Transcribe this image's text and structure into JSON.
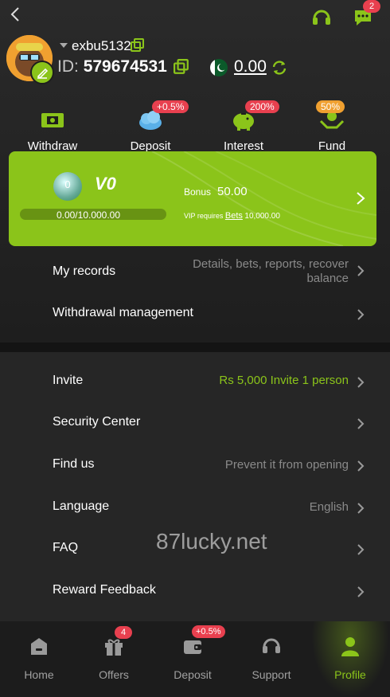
{
  "header": {
    "back_icon": "chevron-left-icon",
    "support_icon": "headset-icon",
    "messages_icon": "chat-icon",
    "messages_badge": "2"
  },
  "profile": {
    "username": "exbu5132",
    "id_label": "ID:",
    "id_value": "579674531",
    "balance": "0.00",
    "flag_icon": "pakistan-flag-icon"
  },
  "quick_actions": [
    {
      "label": "Withdraw",
      "icon": "ticket-icon",
      "badge": ""
    },
    {
      "label": "Deposit",
      "icon": "cloud-icon",
      "badge": "+0.5%"
    },
    {
      "label": "Interest",
      "icon": "piggy-bank-icon",
      "badge": "200%"
    },
    {
      "label": "Fund",
      "icon": "hands-coin-icon",
      "badge": "50%"
    }
  ],
  "vip": {
    "level_badge": "0",
    "level_label": "V0",
    "progress_text": "0.00/10.000.00",
    "progress_fraction": 0,
    "bonus_label": "Bonus",
    "bonus_value": "50.00",
    "requires_prefix": "VIP requires",
    "requires_link": "Bets",
    "requires_value": "10,000.00"
  },
  "records": [
    {
      "title": "My records",
      "value": "Details, bets, reports, recover balance"
    },
    {
      "title": "Withdrawal management",
      "value": ""
    }
  ],
  "menu": [
    {
      "title": "Invite",
      "value": "Rs 5,000  Invite 1 person"
    },
    {
      "title": "Security Center",
      "value": ""
    },
    {
      "title": "Find us",
      "value": "Prevent it from opening"
    },
    {
      "title": "Language",
      "value": "English"
    },
    {
      "title": "FAQ",
      "value": ""
    },
    {
      "title": "Reward Feedback",
      "value": ""
    }
  ],
  "watermark": "87lucky.net",
  "nav": [
    {
      "label": "Home",
      "icon": "home-icon",
      "badge": ""
    },
    {
      "label": "Offers",
      "icon": "gift-icon",
      "badge": "4"
    },
    {
      "label": "Deposit",
      "icon": "wallet-icon",
      "badge": "+0.5%"
    },
    {
      "label": "Support",
      "icon": "headset-icon",
      "badge": ""
    },
    {
      "label": "Profile",
      "icon": "user-icon",
      "badge": ""
    }
  ],
  "colors": {
    "accent": "#8bc41a",
    "badge": "#e8404f",
    "background": "#1a1a1a"
  }
}
